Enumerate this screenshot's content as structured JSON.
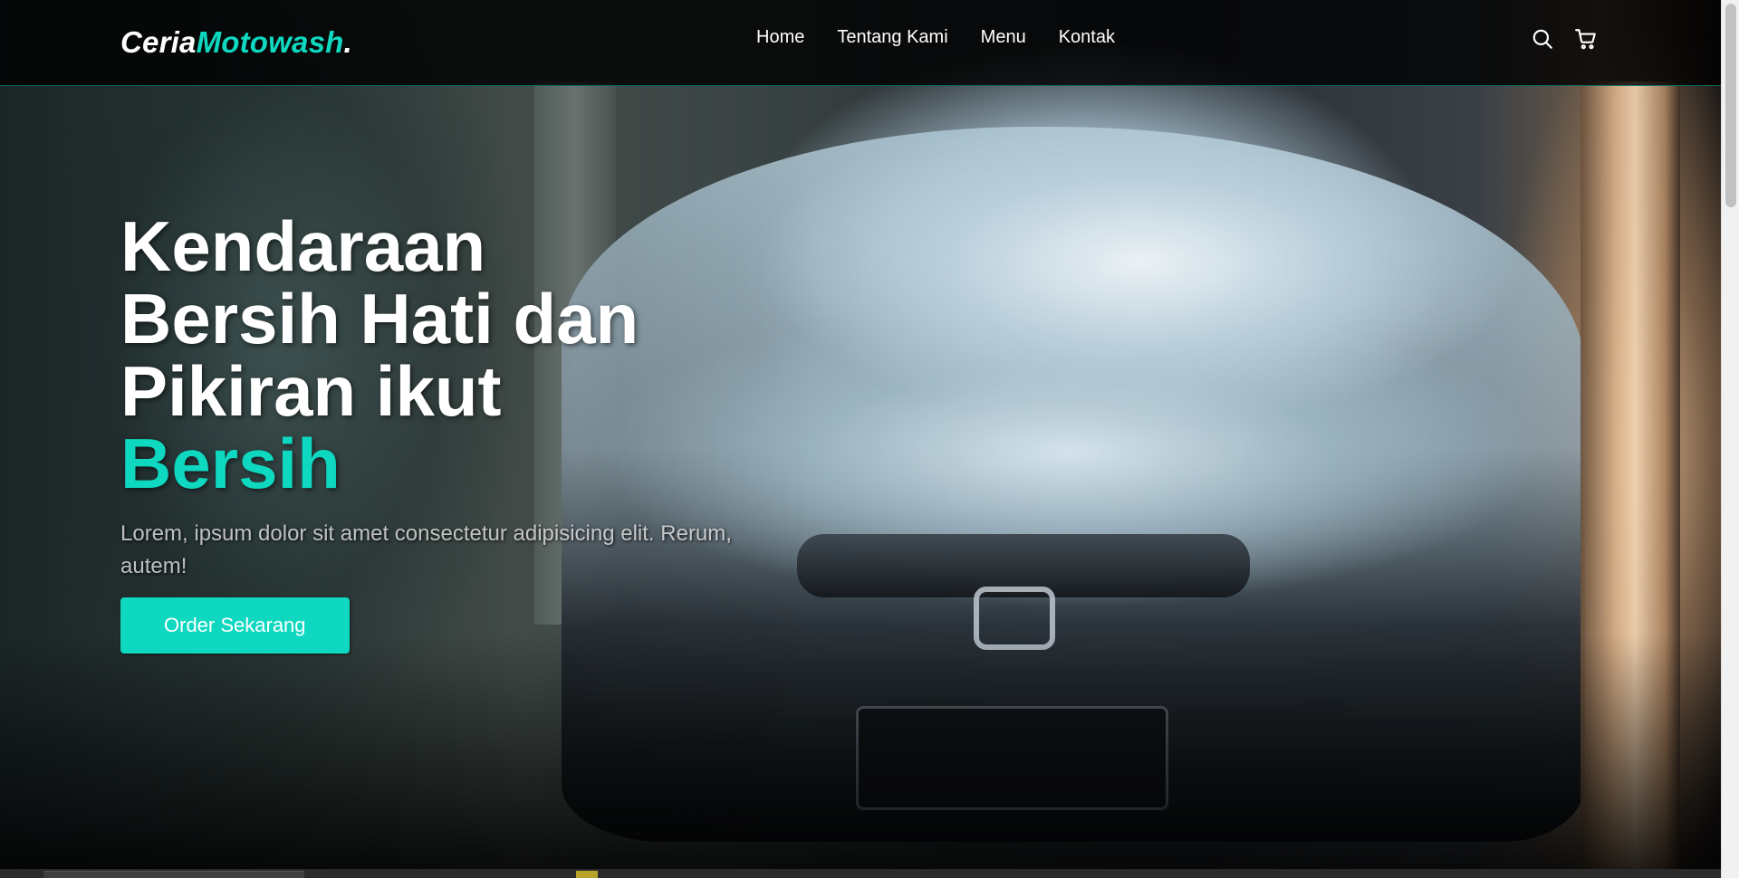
{
  "brand": {
    "name_part1": "Ceria",
    "name_part2": "Motowash",
    "name_suffix": ".",
    "accent_color": "#0ed8c0"
  },
  "nav": {
    "links": [
      "Home",
      "Tentang Kami",
      "Menu",
      "Kontak"
    ],
    "icons": [
      "search-icon",
      "shopping-cart-icon"
    ]
  },
  "hero": {
    "headline_line1": "Kendaraan",
    "headline_line2": "Bersih Hati dan",
    "headline_line3": "Pikiran ikut",
    "headline_accent": "Bersih",
    "description": "Lorem, ipsum dolor sit amet consectetur adipisicing elit. Rerum, autem!",
    "cta_label": "Order Sekarang"
  }
}
